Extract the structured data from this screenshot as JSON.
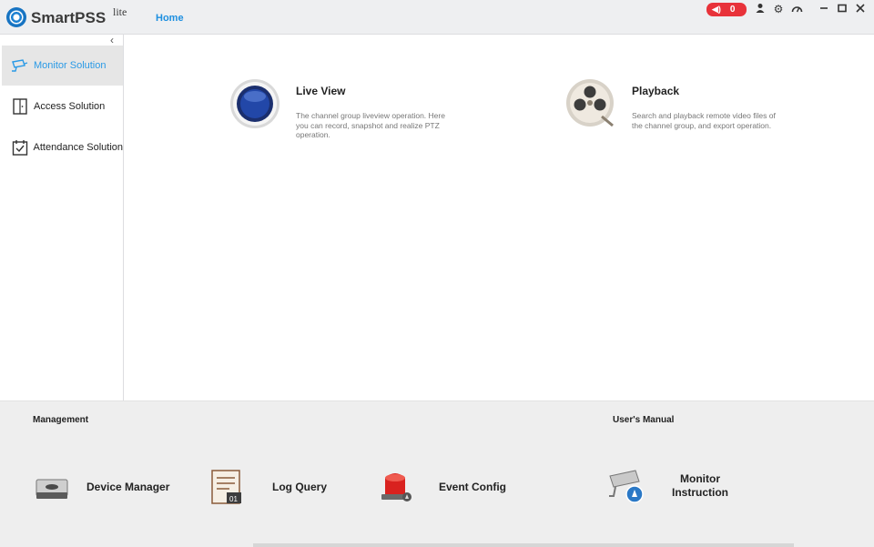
{
  "app": {
    "name": "SmartPSS",
    "suffix": "lite"
  },
  "tabs": [
    {
      "label": "Home"
    }
  ],
  "alarm": {
    "count": "0"
  },
  "toolbar_icons": [
    "user-icon",
    "settings-icon",
    "performance-icon",
    "minimize-icon",
    "maximize-icon",
    "close-icon"
  ],
  "sidebar": {
    "items": [
      {
        "label": "Monitor Solution",
        "icon": "camera-icon",
        "active": true
      },
      {
        "label": "Access Solution",
        "icon": "door-icon",
        "active": false
      },
      {
        "label": "Attendance Solution",
        "icon": "calendar-check-icon",
        "active": false
      }
    ]
  },
  "main": {
    "features": [
      {
        "title": "Live View",
        "description": "The channel group liveview operation. Here you can record, snapshot and realize PTZ operation.",
        "icon": "live-view-icon"
      },
      {
        "title": "Playback",
        "description": "Search and playback remote video files of the channel group, and export operation.",
        "icon": "film-reel-icon"
      }
    ]
  },
  "bottom": {
    "management_title": "Management",
    "manual_title": "User's Manual",
    "tools": [
      {
        "label": "Device Manager",
        "icon": "device-icon"
      },
      {
        "label": "Log Query",
        "icon": "log-icon"
      },
      {
        "label": "Event Config",
        "icon": "alarm-light-icon"
      }
    ],
    "manual": {
      "label_line1": "Monitor",
      "label_line2": "Instruction",
      "icon": "camera-help-icon"
    }
  },
  "colors": {
    "accent": "#1d8fe0",
    "alarm": "#e8323a",
    "panel": "#eeeeee"
  }
}
